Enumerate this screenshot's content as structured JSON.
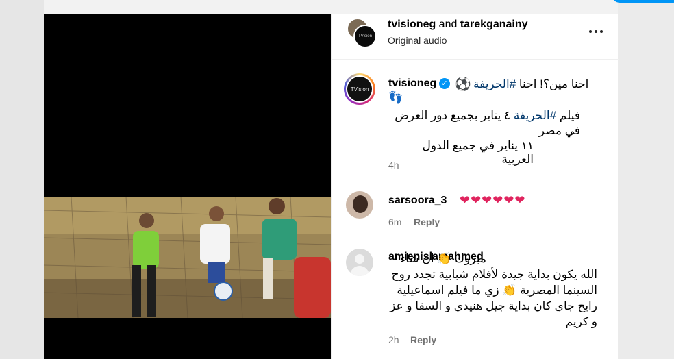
{
  "post": {
    "header_users": "tvisioneg",
    "header_and": " and ",
    "header_user2": "tarekganainy",
    "audio": "Original audio",
    "avatar_text": "TVision"
  },
  "caption": {
    "username": "tvisioneg",
    "line1_pre": "احنا مين؟! احنا ",
    "line1_tag": "#الحريفة",
    "line2_pre": "فيلم ",
    "line2_tag": "#الحريفة",
    "line2_post": " ٤ يناير بجميع دور العرض في مصر",
    "line3": "١١ يناير في جميع الدول العربية",
    "time": "4h",
    "ball_emoji": "⚽",
    "feet_emoji": "👣",
    "verified_icon": "✓"
  },
  "comments": [
    {
      "username": "sarsoora_3",
      "text": "❤❤❤❤❤❤",
      "time": "6m",
      "reply": "Reply"
    },
    {
      "username": "amienislamahmed",
      "text": "مبروك 👏 ان شاء الله يكون بداية جيدة لأفلام شبابية تجدد روح السينما المصرية 👏 زي ما فيلم اسماعيلية رايح جاي كان بداية جيل هنيدي و السقا و عز و كريم",
      "time": "2h",
      "reply": "Reply"
    }
  ],
  "colors": {
    "accent": "#0095f6",
    "hashtag": "#00376b",
    "muted": "#737373"
  }
}
